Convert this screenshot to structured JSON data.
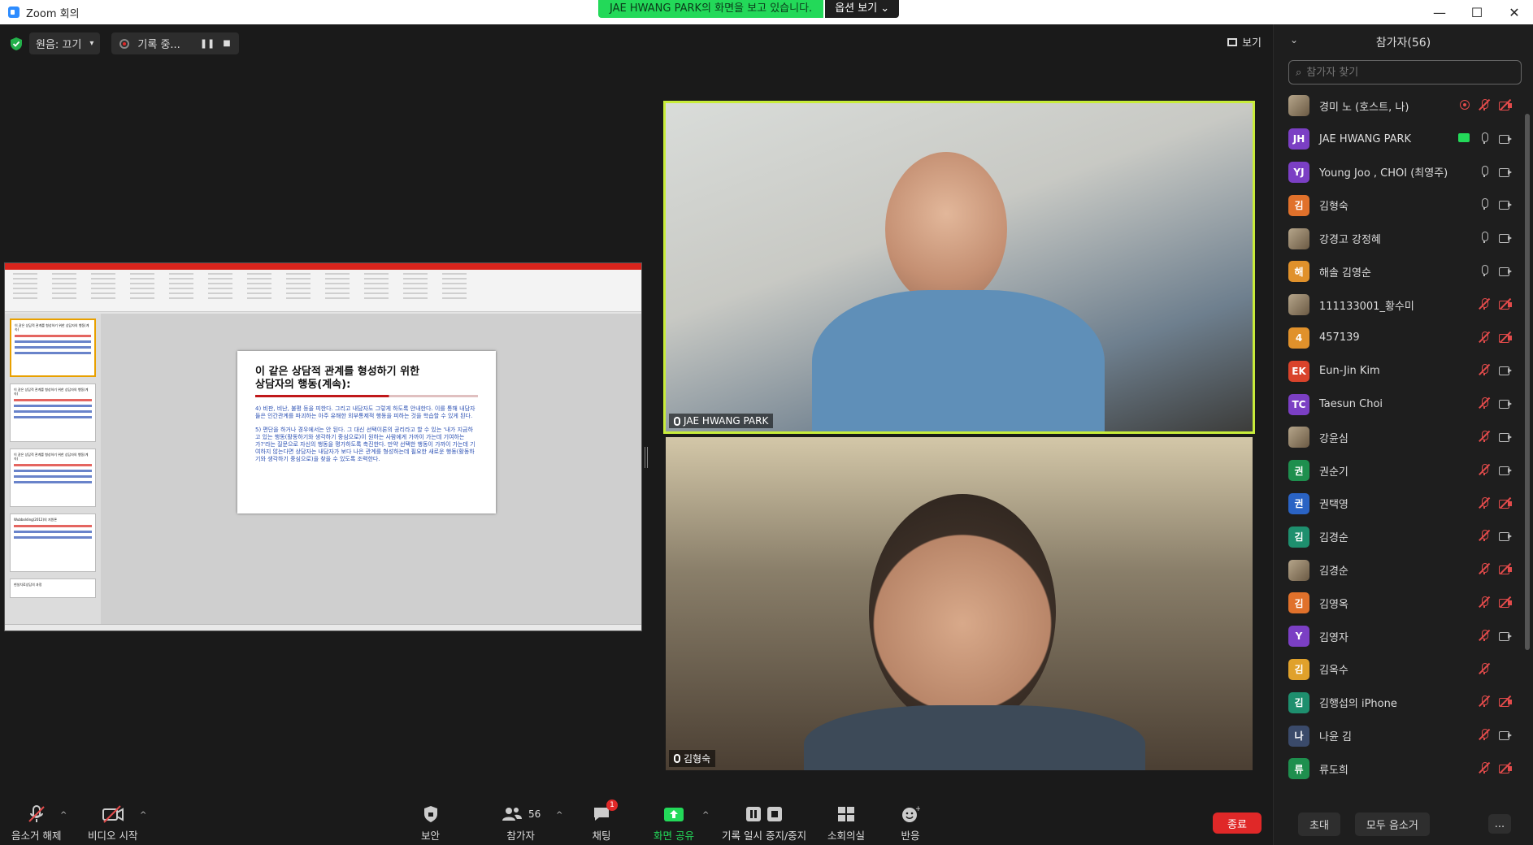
{
  "window": {
    "title": "Zoom 회의",
    "controls": [
      "—",
      "☐",
      "✕"
    ]
  },
  "share_banner": {
    "message": "JAE HWANG PARK의 화면을 보고 있습니다.",
    "options_label": "옵션 보기 ⌄"
  },
  "topbar": {
    "audio_label": "원음: 끄기",
    "recording_label": "기록 중...",
    "view_label": "보기"
  },
  "shared_slide": {
    "title_line1": "이 같은 상담적 관계를 형성하기 위한",
    "title_line2": "상담자의 행동(계속):",
    "para1": "4) 비판, 비난, 불평 등을 피한다. 그리고 내담자도 그렇게 하도록 안내한다. 이를 통해 내담자들은 인간관계를 파괴하는 아주 유해한 외부통제적 행동을 피하는 것을 학습할 수 있게 된다.",
    "para2": "5) 편단을 하거나 경우에서는 안 된다. 그 대신 선택이론의 공리라고 할 수 있는 '내가 지금하고 있는 행동(활동하기와 생각하기 중심으로)이 원하는 사람에게 가까이 가는데 기여하는가?'라는 질문으로 자신의 행동을 평가하도록 촉진한다. 만약 선택한 행동이 가까이 가는데 기여하지 않는다면 상담자는 내담자가 보다 나은 관계를 형성하는데 필요한 새로운 행동(활동하기와 생각하기 중심으로)을 찾을 수 있도록 조력한다.",
    "thumb_titles": [
      "이 같은 상담적 관계를 형성하기 위한 상담자의 행동(계속)",
      "이 같은 상담적 관계를 형성하기 위한 상담자의 행동(계속)",
      "이 같은 상담적 관계를 형성하기 위한 상담자의 행동(계속)",
      "Wubbolding(2012)의 지원론",
      "현실치료상담의 과정"
    ]
  },
  "videos": {
    "top_name": "JAE HWANG PARK",
    "bottom_name": "김형숙"
  },
  "toolbar": {
    "unmute": "음소거 해제",
    "start_video": "비디오 시작",
    "security": "보안",
    "participants": "참가자",
    "participants_count": "56",
    "chat": "채팅",
    "chat_badge": "1",
    "share_screen": "화면 공유",
    "pause_recording": "기록 일시 중지/중지",
    "breakout": "소회의실",
    "reactions": "반응",
    "end": "종료"
  },
  "panel": {
    "title": "참가자(56)",
    "search_placeholder": "참가자 찾기",
    "invite": "초대",
    "mute_all": "모두 음소거",
    "more": "...",
    "participants": [
      {
        "name": "경미 노 (호스트, 나)",
        "avatar": "",
        "color": "#c9a98e",
        "photo": true,
        "rec": true,
        "mic": "muted",
        "cam": "off"
      },
      {
        "name": "JAE HWANG PARK",
        "avatar": "JH",
        "color": "#7b3fc4",
        "share": true,
        "mic": "on",
        "cam": "on"
      },
      {
        "name": "Young Joo , CHOI (최영주)",
        "avatar": "YJ",
        "color": "#7b3fc4",
        "mic": "on",
        "cam": "on"
      },
      {
        "name": "김형숙",
        "avatar": "김",
        "color": "#e0712b",
        "mic": "on",
        "cam": "on"
      },
      {
        "name": "강경고 강정혜",
        "avatar": "",
        "color": "#d8b8a8",
        "photo": true,
        "mic": "on",
        "cam": "on"
      },
      {
        "name": "해솔 김영순",
        "avatar": "해",
        "color": "#e0912b",
        "mic": "on",
        "cam": "on"
      },
      {
        "name": "111133001_황수미",
        "avatar": "",
        "color": "#b89a88",
        "photo": true,
        "mic": "muted",
        "cam": "off"
      },
      {
        "name": "457139",
        "avatar": "4",
        "color": "#e0912b",
        "mic": "muted",
        "cam": "off"
      },
      {
        "name": "Eun-Jin Kim",
        "avatar": "EK",
        "color": "#d9432b",
        "mic": "muted",
        "cam": "on"
      },
      {
        "name": "Taesun Choi",
        "avatar": "TC",
        "color": "#7b3fc4",
        "mic": "muted",
        "cam": "on"
      },
      {
        "name": "강윤심",
        "avatar": "",
        "color": "#7a7a6a",
        "photo": true,
        "mic": "muted",
        "cam": "on"
      },
      {
        "name": "권순기",
        "avatar": "권",
        "color": "#1e8f4e",
        "mic": "muted",
        "cam": "on"
      },
      {
        "name": "권택영",
        "avatar": "권",
        "color": "#2a63c4",
        "mic": "muted",
        "cam": "off"
      },
      {
        "name": "김경순",
        "avatar": "김",
        "color": "#1e8f6e",
        "mic": "muted",
        "cam": "on"
      },
      {
        "name": "김경순",
        "avatar": "",
        "color": "#8a8a7a",
        "photo": true,
        "mic": "muted",
        "cam": "off"
      },
      {
        "name": "김영옥",
        "avatar": "김",
        "color": "#e0712b",
        "mic": "muted",
        "cam": "off"
      },
      {
        "name": "김영자",
        "avatar": "Y",
        "color": "#7b3fc4",
        "mic": "muted",
        "cam": "on"
      },
      {
        "name": "김옥수",
        "avatar": "김",
        "color": "#e0a12b",
        "mic": "muted",
        "cam": "none"
      },
      {
        "name": "김행섭의 iPhone",
        "avatar": "김",
        "color": "#1e8f6e",
        "mic": "muted",
        "cam": "off"
      },
      {
        "name": "나윤 김",
        "avatar": "나",
        "color": "#3a4a6a",
        "mic": "muted",
        "cam": "on"
      },
      {
        "name": "류도희",
        "avatar": "류",
        "color": "#1e8f4e",
        "mic": "muted",
        "cam": "off"
      }
    ]
  }
}
